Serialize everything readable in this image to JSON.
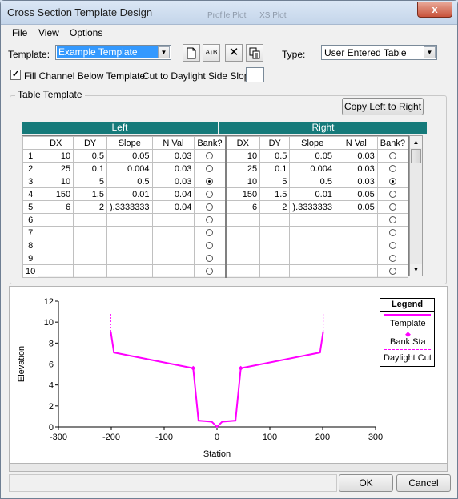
{
  "window": {
    "title": "Cross Section Template Design",
    "background_tabs": [
      "Profile Plot",
      "XS Plot"
    ],
    "close_glyph": "x"
  },
  "menu": [
    "File",
    "View",
    "Options"
  ],
  "template": {
    "label": "Template:",
    "value": "Example Template",
    "type_label": "Type:",
    "type_value": "User Entered Table"
  },
  "toolbar": {
    "icons": [
      "new-file-icon",
      "rename-icon",
      "delete-icon",
      "copy-icon"
    ],
    "rename_glyph": "A↓B",
    "delete_glyph": "✕"
  },
  "options": {
    "fill_channel_label": "Fill Channel Below Template",
    "fill_channel_checked": true,
    "cut_daylight_label": "Cut to Daylight Side Slope:",
    "cut_daylight_value": ""
  },
  "table_template": {
    "group_label": "Table Template",
    "copy_button": "Copy Left to Right",
    "left_header": "Left",
    "right_header": "Right",
    "columns": [
      "DX",
      "DY",
      "Slope",
      "N Val",
      "Bank?"
    ],
    "left_rows": [
      {
        "n": "1",
        "dx": "10",
        "dy": "0.5",
        "slope": "0.05",
        "nval": "0.03",
        "bank": false
      },
      {
        "n": "2",
        "dx": "25",
        "dy": "0.1",
        "slope": "0.004",
        "nval": "0.03",
        "bank": false
      },
      {
        "n": "3",
        "dx": "10",
        "dy": "5",
        "slope": "0.5",
        "nval": "0.03",
        "bank": true
      },
      {
        "n": "4",
        "dx": "150",
        "dy": "1.5",
        "slope": "0.01",
        "nval": "0.04",
        "bank": false
      },
      {
        "n": "5",
        "dx": "6",
        "dy": "2",
        "slope": ").3333333",
        "nval": "0.04",
        "bank": false
      },
      {
        "n": "6",
        "dx": "",
        "dy": "",
        "slope": "",
        "nval": "",
        "bank": false
      },
      {
        "n": "7",
        "dx": "",
        "dy": "",
        "slope": "",
        "nval": "",
        "bank": false
      },
      {
        "n": "8",
        "dx": "",
        "dy": "",
        "slope": "",
        "nval": "",
        "bank": false
      },
      {
        "n": "9",
        "dx": "",
        "dy": "",
        "slope": "",
        "nval": "",
        "bank": false
      },
      {
        "n": "10",
        "dx": "",
        "dy": "",
        "slope": "",
        "nval": "",
        "bank": false
      }
    ],
    "right_rows": [
      {
        "dx": "10",
        "dy": "0.5",
        "slope": "0.05",
        "nval": "0.03",
        "bank": false
      },
      {
        "dx": "25",
        "dy": "0.1",
        "slope": "0.004",
        "nval": "0.03",
        "bank": false
      },
      {
        "dx": "10",
        "dy": "5",
        "slope": "0.5",
        "nval": "0.03",
        "bank": true
      },
      {
        "dx": "150",
        "dy": "1.5",
        "slope": "0.01",
        "nval": "0.05",
        "bank": false
      },
      {
        "dx": "6",
        "dy": "2",
        "slope": ").3333333",
        "nval": "0.05",
        "bank": false
      },
      {
        "dx": "",
        "dy": "",
        "slope": "",
        "nval": "",
        "bank": false
      },
      {
        "dx": "",
        "dy": "",
        "slope": "",
        "nval": "",
        "bank": false
      },
      {
        "dx": "",
        "dy": "",
        "slope": "",
        "nval": "",
        "bank": false
      },
      {
        "dx": "",
        "dy": "",
        "slope": "",
        "nval": "",
        "bank": false
      },
      {
        "dx": "",
        "dy": "",
        "slope": "",
        "nval": "",
        "bank": false
      }
    ]
  },
  "chart_data": {
    "type": "line",
    "xlabel": "Station",
    "ylabel": "Elevation",
    "xlim": [
      -300,
      300
    ],
    "ylim": [
      0,
      12
    ],
    "xticks": [
      -300,
      -200,
      -100,
      0,
      100,
      200,
      300
    ],
    "yticks": [
      0,
      2,
      4,
      6,
      8,
      10,
      12
    ],
    "legend_title": "Legend",
    "legend_placement": "top-right",
    "series": [
      {
        "name": "Template",
        "color": "#ff00ff",
        "style": "solid",
        "x": [
          -201,
          -195,
          -45,
          -35,
          -10,
          0,
          10,
          35,
          45,
          195,
          201
        ],
        "y": [
          9.1,
          7.1,
          5.6,
          0.6,
          0.5,
          0,
          0.5,
          0.6,
          5.6,
          7.1,
          9.1
        ]
      },
      {
        "name": "Bank Sta",
        "color": "#ff00ff",
        "style": "marker",
        "x": [
          -45,
          45
        ],
        "y": [
          5.6,
          5.6
        ]
      },
      {
        "name": "Daylight Cut",
        "color": "#ff00ff",
        "style": "dashed",
        "segments": [
          {
            "x": [
              -201,
              -201
            ],
            "y": [
              9.1,
              11
            ]
          },
          {
            "x": [
              201,
              201
            ],
            "y": [
              9.1,
              11
            ]
          }
        ]
      }
    ]
  },
  "buttons": {
    "ok": "OK",
    "cancel": "Cancel"
  }
}
